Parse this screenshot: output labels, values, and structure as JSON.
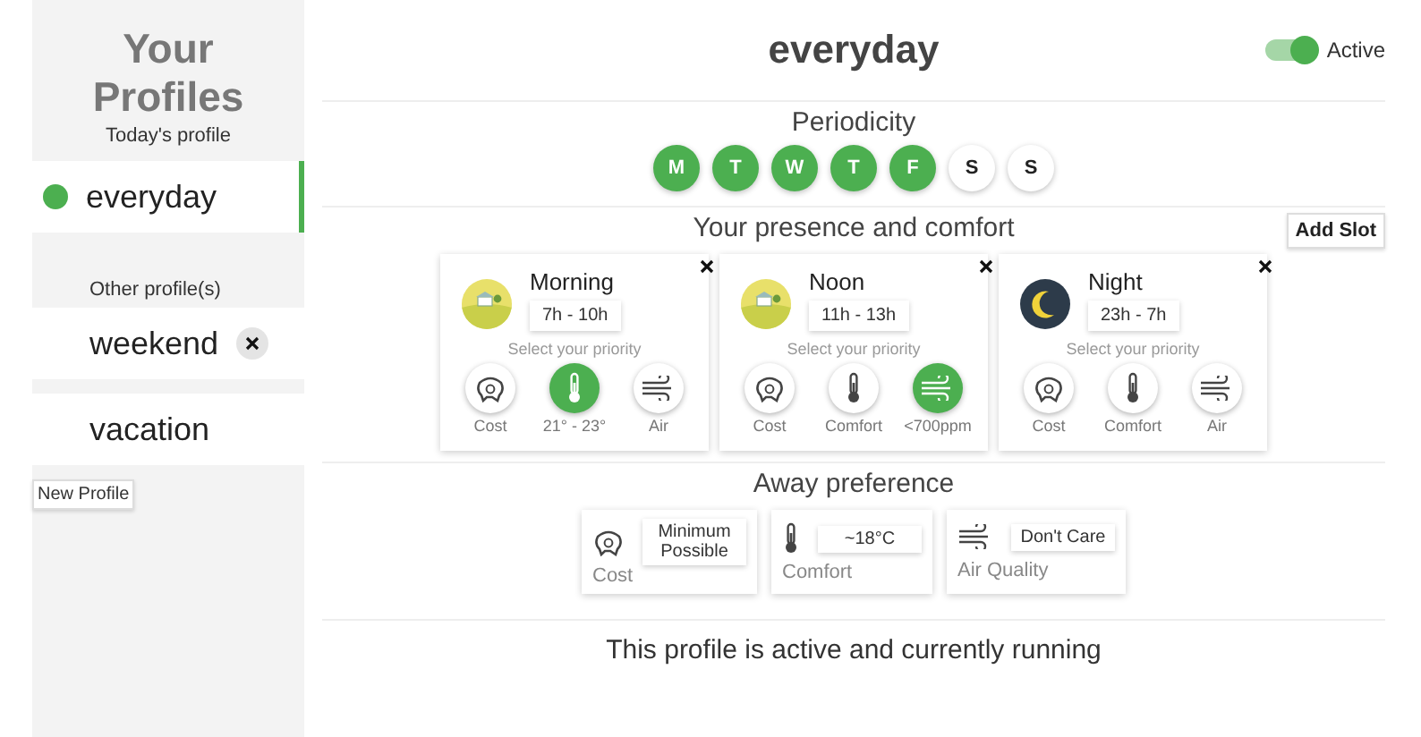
{
  "sidebar": {
    "title": "Your Profiles",
    "today_label": "Today's profile",
    "today_profiles": [
      {
        "name": "everyday",
        "selected": true
      }
    ],
    "other_label": "Other profile(s)",
    "other_profiles": [
      {
        "name": "weekend",
        "selected": false,
        "removable": true
      },
      {
        "name": "vacation",
        "selected": false,
        "removable": false
      }
    ],
    "new_profile_button": "New Profile"
  },
  "header": {
    "title": "everyday",
    "toggle": {
      "label": "Active",
      "on": true
    }
  },
  "periodicity": {
    "title": "Periodicity",
    "days": [
      {
        "label": "M",
        "selected": true
      },
      {
        "label": "T",
        "selected": true
      },
      {
        "label": "W",
        "selected": true
      },
      {
        "label": "T",
        "selected": true
      },
      {
        "label": "F",
        "selected": true
      },
      {
        "label": "S",
        "selected": false
      },
      {
        "label": "S",
        "selected": false
      }
    ]
  },
  "presence": {
    "title": "Your presence and comfort",
    "add_button": "Add Slot",
    "slots": [
      {
        "kind": "day",
        "name": "Morning",
        "time": "7h - 10h",
        "hint": "Select your priority",
        "priorities": [
          {
            "kind": "cost",
            "label": "Cost",
            "selected": false
          },
          {
            "kind": "comfort",
            "label": "21° - 23°",
            "selected": true
          },
          {
            "kind": "air",
            "label": "Air",
            "selected": false
          }
        ]
      },
      {
        "kind": "day",
        "name": "Noon",
        "time": "11h - 13h",
        "hint": "Select your priority",
        "priorities": [
          {
            "kind": "cost",
            "label": "Cost",
            "selected": false
          },
          {
            "kind": "comfort",
            "label": "Comfort",
            "selected": false
          },
          {
            "kind": "air",
            "label": "<700ppm",
            "selected": true
          }
        ]
      },
      {
        "kind": "night",
        "name": "Night",
        "time": "23h - 7h",
        "hint": "Select your priority",
        "priorities": [
          {
            "kind": "cost",
            "label": "Cost",
            "selected": false
          },
          {
            "kind": "comfort",
            "label": "Comfort",
            "selected": false
          },
          {
            "kind": "air",
            "label": "Air",
            "selected": false
          }
        ]
      }
    ]
  },
  "away": {
    "title": "Away preference",
    "items": [
      {
        "kind": "cost",
        "label": "Cost",
        "value": "Minimum Possible"
      },
      {
        "kind": "comfort",
        "label": "Comfort",
        "value": "~18°C"
      },
      {
        "kind": "air",
        "label": "Air Quality",
        "value": "Don't Care"
      }
    ]
  },
  "status": "This profile is active and currently running"
}
